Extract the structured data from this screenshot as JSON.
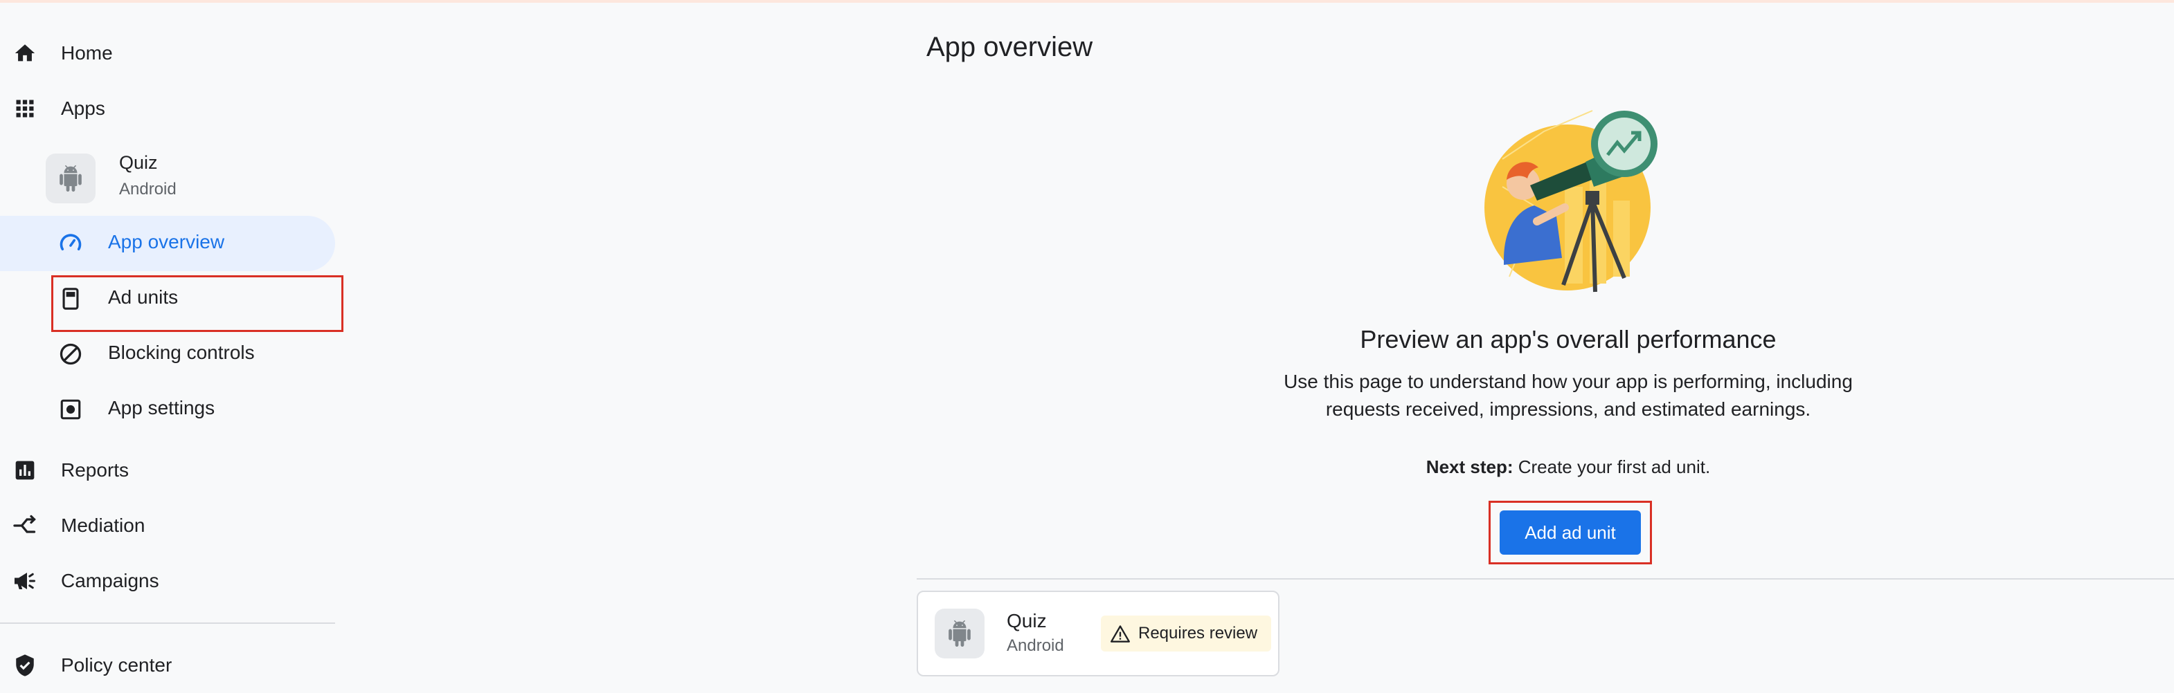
{
  "sidebar": {
    "home": "Home",
    "apps": "Apps",
    "app": {
      "name": "Quiz",
      "platform": "Android"
    },
    "app_items": [
      "App overview",
      "Ad units",
      "Blocking controls",
      "App settings"
    ],
    "reports": "Reports",
    "mediation": "Mediation",
    "campaigns": "Campaigns",
    "policy_center": "Policy center"
  },
  "main": {
    "title": "App overview",
    "heading": "Preview an app's overall performance",
    "description_line1": "Use this page to understand how your app is performing, including",
    "description_line2": "requests received, impressions, and estimated earnings.",
    "next_step_label": "Next step:",
    "next_step_text": " Create your first ad unit.",
    "add_button": "Add ad unit"
  },
  "app_card": {
    "name": "Quiz",
    "platform": "Android",
    "status": "Requires review"
  },
  "colors": {
    "accent": "#1a73e8",
    "active_bg": "#e8f0fe",
    "highlight": "#d93025",
    "warning_bg": "#fef7e0"
  }
}
